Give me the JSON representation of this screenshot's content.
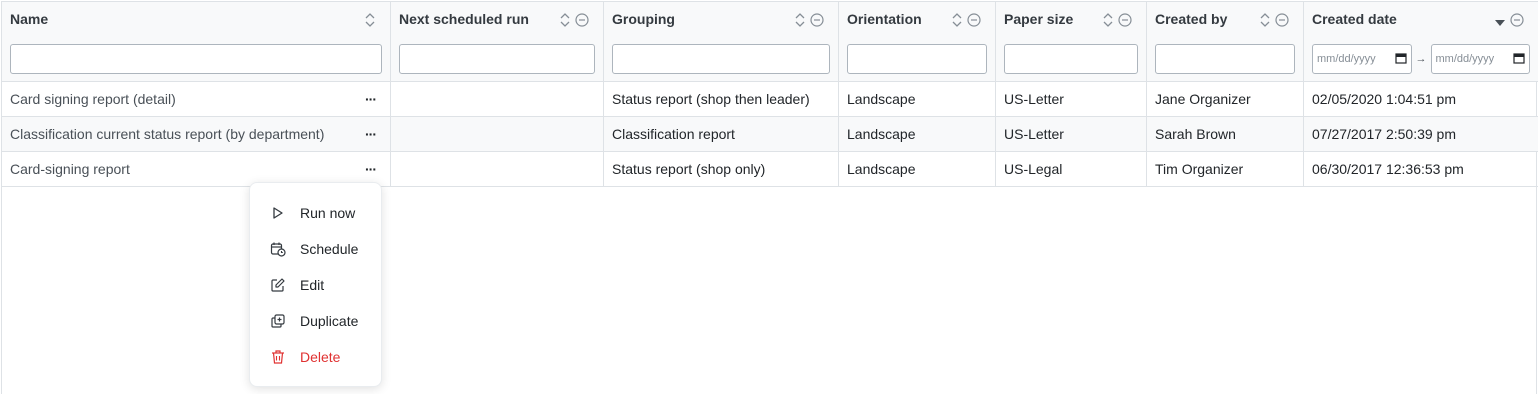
{
  "columns": [
    {
      "key": "name",
      "label": "Name"
    },
    {
      "key": "next_run",
      "label": "Next scheduled run"
    },
    {
      "key": "grouping",
      "label": "Grouping"
    },
    {
      "key": "orientation",
      "label": "Orientation"
    },
    {
      "key": "paper_size",
      "label": "Paper size"
    },
    {
      "key": "created_by",
      "label": "Created by"
    },
    {
      "key": "created_date",
      "label": "Created date"
    }
  ],
  "filters": {
    "name": "",
    "next_run": "",
    "grouping": "",
    "orientation": "",
    "paper_size": "",
    "created_by": "",
    "date_from_placeholder": "mm/dd/yyyy",
    "date_to_placeholder": "mm/dd/yyyy",
    "date_range_arrow": "→"
  },
  "rows": [
    {
      "name": "Card signing report (detail)",
      "next_run": "",
      "grouping": "Status report (shop then leader)",
      "orientation": "Landscape",
      "paper_size": "US-Letter",
      "created_by": "Jane Organizer",
      "created_date": "02/05/2020 1:04:51 pm"
    },
    {
      "name": "Classification current status report (by department)",
      "next_run": "",
      "grouping": "Classification report",
      "orientation": "Landscape",
      "paper_size": "US-Letter",
      "created_by": "Sarah Brown",
      "created_date": "07/27/2017 2:50:39 pm"
    },
    {
      "name": "Card-signing report",
      "next_run": "",
      "grouping": "Status report (shop only)",
      "orientation": "Landscape",
      "paper_size": "US-Legal",
      "created_by": "Tim Organizer",
      "created_date": "06/30/2017 12:36:53 pm"
    }
  ],
  "row_actions_glyph": "···",
  "menu": {
    "items": [
      {
        "label": "Run now",
        "icon": "play-icon"
      },
      {
        "label": "Schedule",
        "icon": "calendar-clock-icon"
      },
      {
        "label": "Edit",
        "icon": "edit-icon"
      },
      {
        "label": "Duplicate",
        "icon": "duplicate-icon"
      },
      {
        "label": "Delete",
        "icon": "trash-icon",
        "color": "#e03131"
      }
    ]
  }
}
